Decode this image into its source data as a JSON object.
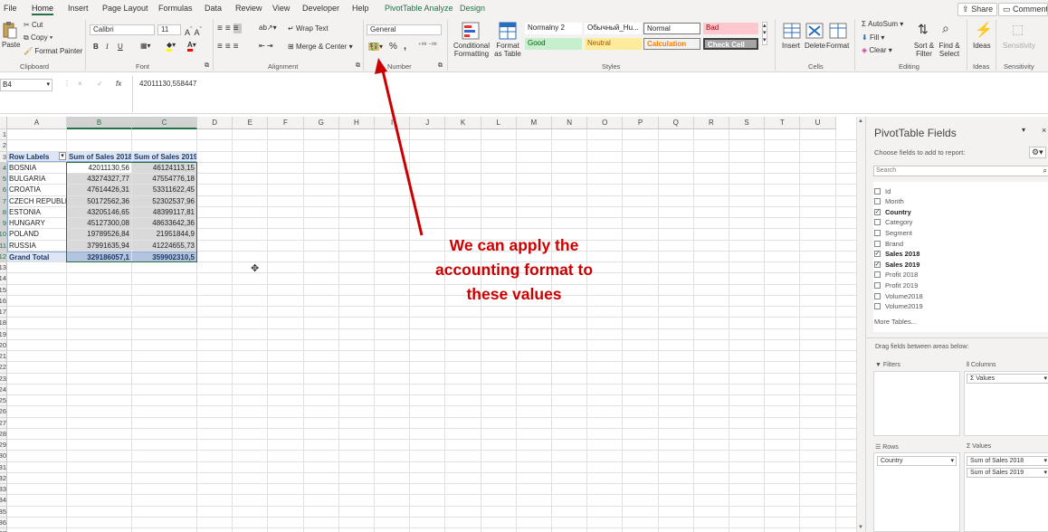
{
  "tabs": [
    "File",
    "Home",
    "Insert",
    "Page Layout",
    "Formulas",
    "Data",
    "Review",
    "View",
    "Developer",
    "Help",
    "PivotTable Analyze",
    "Design"
  ],
  "top_buttons": {
    "share": "Share",
    "comments": "Comments"
  },
  "ribbon": {
    "clipboard": {
      "paste": "Paste",
      "cut": "Cut",
      "copy": "Copy",
      "format_painter": "Format Painter",
      "label": "Clipboard"
    },
    "font": {
      "name": "Calibri",
      "size": "11",
      "bold": "B",
      "italic": "I",
      "underline": "U",
      "label": "Font"
    },
    "alignment": {
      "wrap_text": "Wrap Text",
      "merge": "Merge & Center",
      "label": "Alignment"
    },
    "number": {
      "format": "General",
      "percent": "%",
      "comma": ",",
      "label": "Number"
    },
    "styles": {
      "conditional": "Conditional Formatting",
      "format_table": "Format as Table",
      "cells": [
        {
          "label": "Normalny 2",
          "bg": "#ffffff",
          "color": "#222222"
        },
        {
          "label": "Обычный_Hu...",
          "bg": "#ffffff",
          "color": "#222222"
        },
        {
          "label": "Normal",
          "bg": "#ffffff",
          "color": "#222222"
        },
        {
          "label": "Bad",
          "bg": "#ffc7ce",
          "color": "#9c0006"
        },
        {
          "label": "Good",
          "bg": "#c6efce",
          "color": "#006100"
        },
        {
          "label": "Neutral",
          "bg": "#ffeb9c",
          "color": "#9c5700"
        },
        {
          "label": "Calculation",
          "bg": "#f2f2f2",
          "color": "#fa7d00"
        },
        {
          "label": "Check Cell",
          "bg": "#a5a5a5",
          "color": "#ffffff"
        }
      ],
      "label": "Styles"
    },
    "cells": {
      "insert": "Insert",
      "delete": "Delete",
      "format": "Format",
      "label": "Cells"
    },
    "editing": {
      "autosum": "AutoSum",
      "fill": "Fill",
      "clear": "Clear",
      "sort_filter": "Sort & Filter",
      "find_select": "Find & Select",
      "label": "Editing"
    },
    "ideas": {
      "ideas": "Ideas",
      "label": "Ideas"
    },
    "sensitivity": {
      "sensitivity": "Sensitivity",
      "label": "Sensitivity"
    }
  },
  "formula_bar": {
    "name_box": "B4",
    "cancel": "×",
    "enter": "✓",
    "fx": "fx",
    "value": "42011130,558447"
  },
  "sheet": {
    "columns": [
      "A",
      "B",
      "C",
      "D",
      "E",
      "F",
      "G",
      "H",
      "I",
      "J",
      "K",
      "L",
      "M",
      "N",
      "O",
      "P",
      "Q",
      "R",
      "S",
      "T",
      "U"
    ],
    "row_numbers": [
      "1",
      "2",
      "3",
      "4",
      "5",
      "6",
      "7",
      "8",
      "9",
      "10",
      "11",
      "12",
      "13",
      "14",
      "15",
      "16",
      "17",
      "18",
      "19",
      "20",
      "21",
      "22",
      "23",
      "24",
      "25",
      "26",
      "27",
      "28",
      "29",
      "30",
      "31",
      "32",
      "33",
      "34",
      "35",
      "36",
      "37"
    ],
    "header": [
      "Row Labels",
      "Sum of Sales 2018",
      "Sum of Sales 2019"
    ],
    "rows": [
      [
        "BOSNIA",
        "42011130,56",
        "46124113,15"
      ],
      [
        "BULGARIA",
        "43274327,77",
        "47554776,18"
      ],
      [
        "CROATIA",
        "47614426,31",
        "53311622,45"
      ],
      [
        "CZECH REPUBLIC",
        "50172562,36",
        "52302537,96"
      ],
      [
        "ESTONIA",
        "43205146,65",
        "48399117,81"
      ],
      [
        "HUNGARY",
        "45127300,08",
        "48633642,36"
      ],
      [
        "POLAND",
        "19789526,84",
        "21951844,9"
      ],
      [
        "RUSSIA",
        "37991635,94",
        "41224655,73"
      ]
    ],
    "total": [
      "Grand Total",
      "329186057,1",
      "359902310,5"
    ]
  },
  "annotation": {
    "text": "We can apply the accounting format to these values",
    "color": "#cc0000"
  },
  "pivot_pane": {
    "title": "PivotTable Fields",
    "subtitle": "Choose fields to add to report:",
    "search_placeholder": "Search",
    "fields": [
      {
        "name": "Id",
        "checked": false
      },
      {
        "name": "Month",
        "checked": false
      },
      {
        "name": "Country",
        "checked": true
      },
      {
        "name": "Category",
        "checked": false
      },
      {
        "name": "Segment",
        "checked": false
      },
      {
        "name": "Brand",
        "checked": false
      },
      {
        "name": "Sales 2018",
        "checked": true
      },
      {
        "name": "Sales 2019",
        "checked": true
      },
      {
        "name": "Profit 2018",
        "checked": false
      },
      {
        "name": "Profit 2019",
        "checked": false
      },
      {
        "name": "Volume2018",
        "checked": false
      },
      {
        "name": "Volume2019",
        "checked": false
      }
    ],
    "more_tables": "More Tables...",
    "drag_hint": "Drag fields between areas below:",
    "filters_label": "Filters",
    "columns_label": "Columns",
    "columns_item": "Σ Values",
    "rows_label": "Rows",
    "rows_item": "Country",
    "values_label": "Values",
    "values_items": [
      "Sum of Sales 2018",
      "Sum of Sales 2019"
    ]
  }
}
